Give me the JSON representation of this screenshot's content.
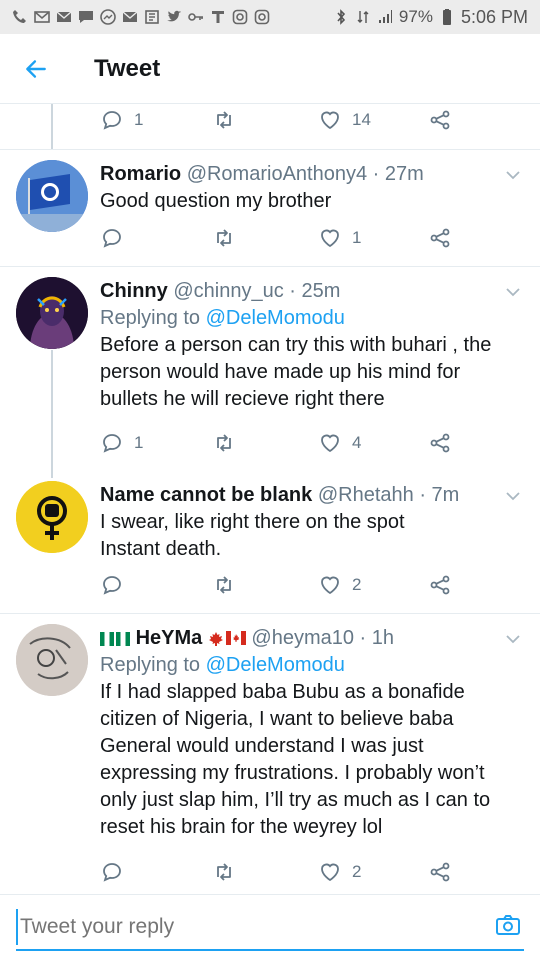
{
  "status_bar": {
    "battery": "97%",
    "time": "5:06 PM"
  },
  "header": {
    "title": "Tweet"
  },
  "top_actions": {
    "replies": "1",
    "likes": "14"
  },
  "tweets": [
    {
      "name": "Romario",
      "handle": "@RomarioAnthony4",
      "time": "· 27m",
      "text": "Good question my brother",
      "replies": "",
      "likes": "1"
    },
    {
      "name": "Chinny",
      "handle": "@chinny_uc",
      "time": "· 25m",
      "replying_prefix": "Replying to ",
      "replying_to": "@DeleMomodu",
      "text": "Before a person can try this with buhari , the person would have made up his mind for bullets he will recieve right there",
      "replies": "1",
      "likes": "4"
    },
    {
      "name": "Name cannot be blank",
      "handle": "@Rhetahh",
      "time": "· 7m",
      "text": "I swear, like right there on the spot Instant death.",
      "replies": "",
      "likes": "2"
    },
    {
      "name": "HeYMa",
      "handle": "@heyma10",
      "time": "· 1h",
      "replying_prefix": "Replying to ",
      "replying_to": "@DeleMomodu",
      "text": "If I had slapped baba Bubu as a bonafide citizen of Nigeria, I want to believe baba General would understand I was just expressing my frustrations. I probably won’t only just slap him, I’ll try as much as I can to reset his brain for the weyrey lol",
      "replies": "",
      "likes": "2"
    }
  ],
  "reply_bar": {
    "placeholder": "Tweet your reply"
  },
  "colors": {
    "accent": "#1da1f2",
    "secondary_text": "#657786",
    "divider": "#e6ecf0"
  },
  "icons": [
    "back-arrow-icon",
    "reply-icon",
    "retweet-icon",
    "like-icon",
    "share-icon",
    "chevron-down-icon",
    "camera-icon"
  ]
}
